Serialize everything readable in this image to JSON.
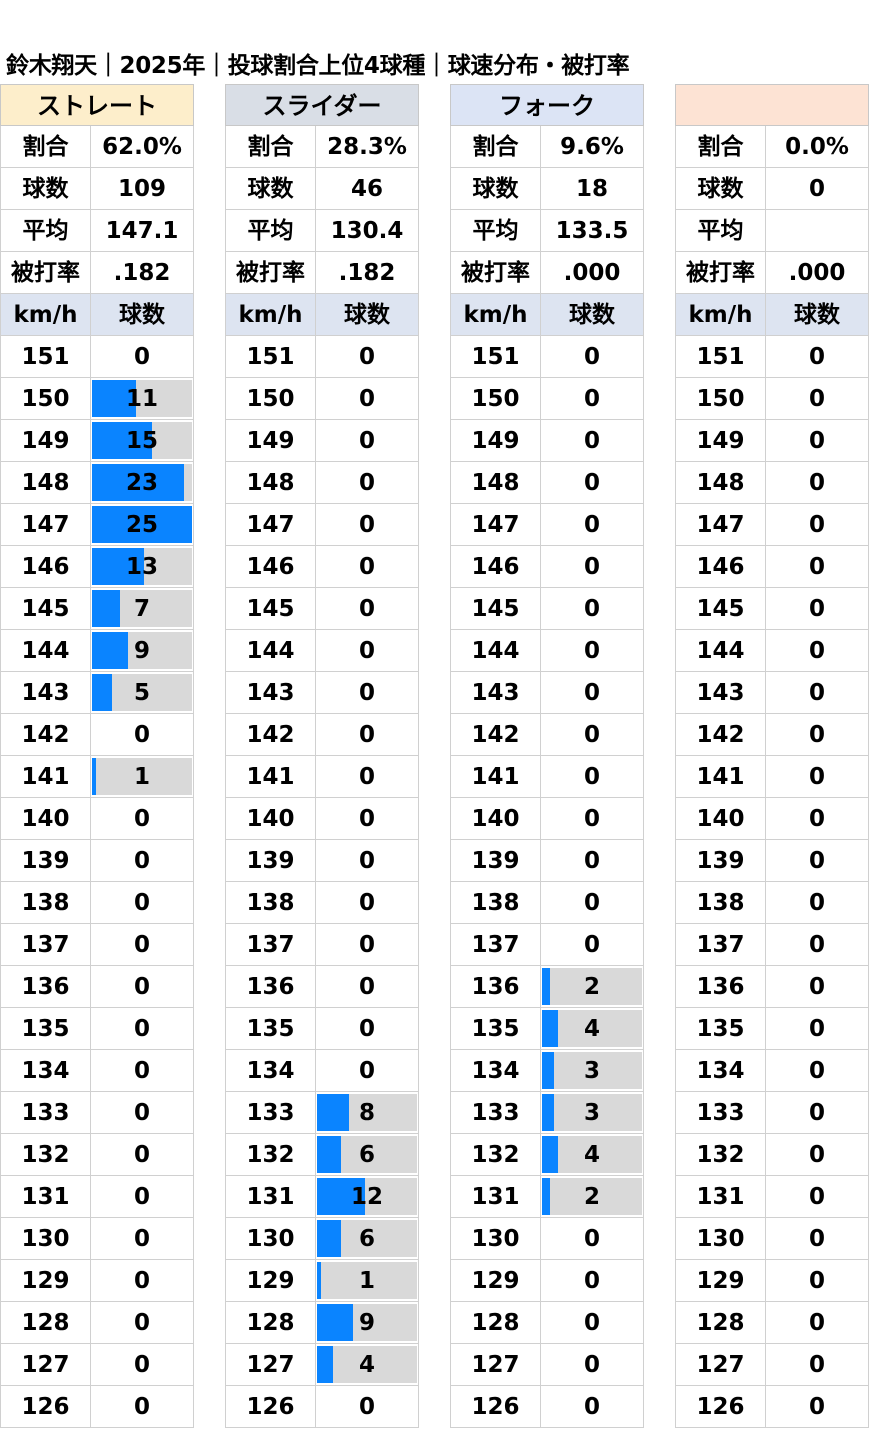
{
  "title": "鈴木翔天｜2025年｜投球割合上位4球種｜球速分布・被打率",
  "labels": {
    "ratio": "割合",
    "count": "球数",
    "avg": "平均",
    "baa": "被打率",
    "kmh": "km/h",
    "pitches": "球数"
  },
  "speeds": [
    151,
    150,
    149,
    148,
    147,
    146,
    145,
    144,
    143,
    142,
    141,
    140,
    139,
    138,
    137,
    136,
    135,
    134,
    133,
    132,
    131,
    130,
    129,
    128,
    127,
    126
  ],
  "bar_max": 25,
  "pitches": [
    {
      "name": "ストレート",
      "header_color": "#fdeecb",
      "ratio": "62.0%",
      "count": "109",
      "avg": "147.1",
      "baa": ".182",
      "counts": [
        0,
        11,
        15,
        23,
        25,
        13,
        7,
        9,
        5,
        0,
        1,
        0,
        0,
        0,
        0,
        0,
        0,
        0,
        0,
        0,
        0,
        0,
        0,
        0,
        0,
        0
      ]
    },
    {
      "name": "スライダー",
      "header_color": "#d9dee6",
      "ratio": "28.3%",
      "count": "46",
      "avg": "130.4",
      "baa": ".182",
      "counts": [
        0,
        0,
        0,
        0,
        0,
        0,
        0,
        0,
        0,
        0,
        0,
        0,
        0,
        0,
        0,
        0,
        0,
        0,
        8,
        6,
        12,
        6,
        1,
        9,
        4,
        0
      ]
    },
    {
      "name": "フォーク",
      "header_color": "#dce4f5",
      "ratio": "9.6%",
      "count": "18",
      "avg": "133.5",
      "baa": ".000",
      "counts": [
        0,
        0,
        0,
        0,
        0,
        0,
        0,
        0,
        0,
        0,
        0,
        0,
        0,
        0,
        0,
        2,
        4,
        3,
        3,
        4,
        2,
        0,
        0,
        0,
        0,
        0
      ]
    },
    {
      "name": "",
      "header_color": "#fde3d4",
      "ratio": "0.0%",
      "count": "0",
      "avg": "",
      "baa": ".000",
      "counts": [
        0,
        0,
        0,
        0,
        0,
        0,
        0,
        0,
        0,
        0,
        0,
        0,
        0,
        0,
        0,
        0,
        0,
        0,
        0,
        0,
        0,
        0,
        0,
        0,
        0,
        0
      ]
    }
  ]
}
